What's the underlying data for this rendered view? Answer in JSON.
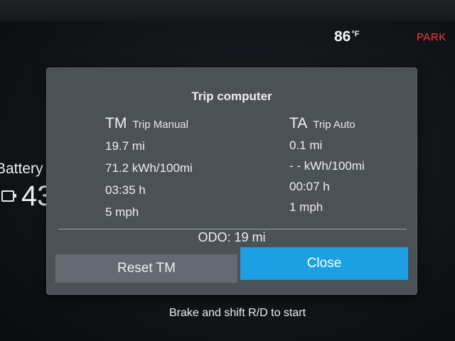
{
  "status_bar": {
    "temperature_value": "86",
    "temperature_unit": "°F",
    "gear": "PARK"
  },
  "battery": {
    "label": "Battery",
    "value_partial": "43"
  },
  "dialog": {
    "title": "Trip computer",
    "trip_manual": {
      "abbr": "TM",
      "name": "Trip Manual",
      "distance": "19.7 mi",
      "efficiency": "71.2 kWh/100mi",
      "duration": "03:35 h",
      "speed": "5 mph"
    },
    "trip_auto": {
      "abbr": "TA",
      "name": "Trip Auto",
      "distance": "0.1 mi",
      "efficiency": "- - kWh/100mi",
      "duration": "00:07 h",
      "speed": "1 mph"
    },
    "odometer": "ODO:  19 mi",
    "reset_label": "Reset TM",
    "close_label": "Close"
  },
  "hint": "Brake and shift R/D to start",
  "colors": {
    "park": "#ff3b30",
    "close_button": "#1d9fe3",
    "reset_button": "#636a72",
    "dialog_bg": "#4b5157"
  }
}
